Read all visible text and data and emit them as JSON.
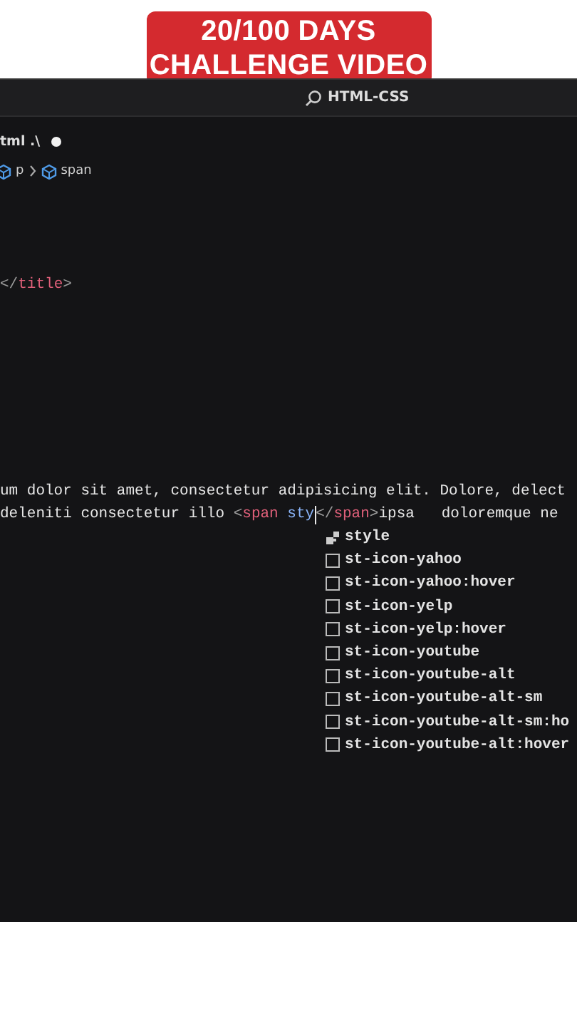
{
  "banner": {
    "title": "20/100 DAYS CHALLENGE VIDEO"
  },
  "title_bar": {
    "search": "HTML-CSS"
  },
  "tab": {
    "label": "tml .\\",
    "modified": true
  },
  "breadcrumb": [
    "p",
    "span"
  ],
  "code": [
    {
      "tokens": [
        {
          "kind": "punct",
          "text": "</"
        },
        {
          "kind": "tag",
          "text": "title"
        },
        {
          "kind": "punct",
          "text": ">"
        }
      ]
    },
    {
      "tokens": [
        {
          "kind": "text",
          "text": "um dolor sit amet, consectetur adipisicing elit. Dolore, delect"
        }
      ]
    },
    {
      "tokens": [
        {
          "kind": "text",
          "text": "deleniti consectetur illo "
        },
        {
          "kind": "punct",
          "text": "<"
        },
        {
          "kind": "tag",
          "text": "span"
        },
        {
          "kind": "attr",
          "text": " sty"
        },
        {
          "kind": "cursor"
        },
        {
          "kind": "punct",
          "text": "</"
        },
        {
          "kind": "tag",
          "text": "span"
        },
        {
          "kind": "punct",
          "text": ">"
        },
        {
          "kind": "text",
          "text": "ipsa   doloremque ne"
        }
      ]
    }
  ],
  "suggestions": [
    {
      "kind": "snippet",
      "label": "**sty**le"
    },
    {
      "kind": "class",
      "label": "**st**-icon-**y**ahoo"
    },
    {
      "kind": "class",
      "label": "**st**-icon-**y**ahoo:hover"
    },
    {
      "kind": "class",
      "label": "**st**-icon-**y**elp"
    },
    {
      "kind": "class",
      "label": "**st**-icon-**y**elp:hover"
    },
    {
      "kind": "class",
      "label": "**st**-icon-**y**outube"
    },
    {
      "kind": "class",
      "label": "**st**-icon-**y**outube-alt"
    },
    {
      "kind": "class",
      "label": "**st**-icon-**y**outube-alt-sm"
    },
    {
      "kind": "class",
      "label": "**st**-icon-**y**outube-alt-sm:ho"
    },
    {
      "kind": "class",
      "label": "**st**-icon-**y**outube-alt:hover"
    }
  ]
}
